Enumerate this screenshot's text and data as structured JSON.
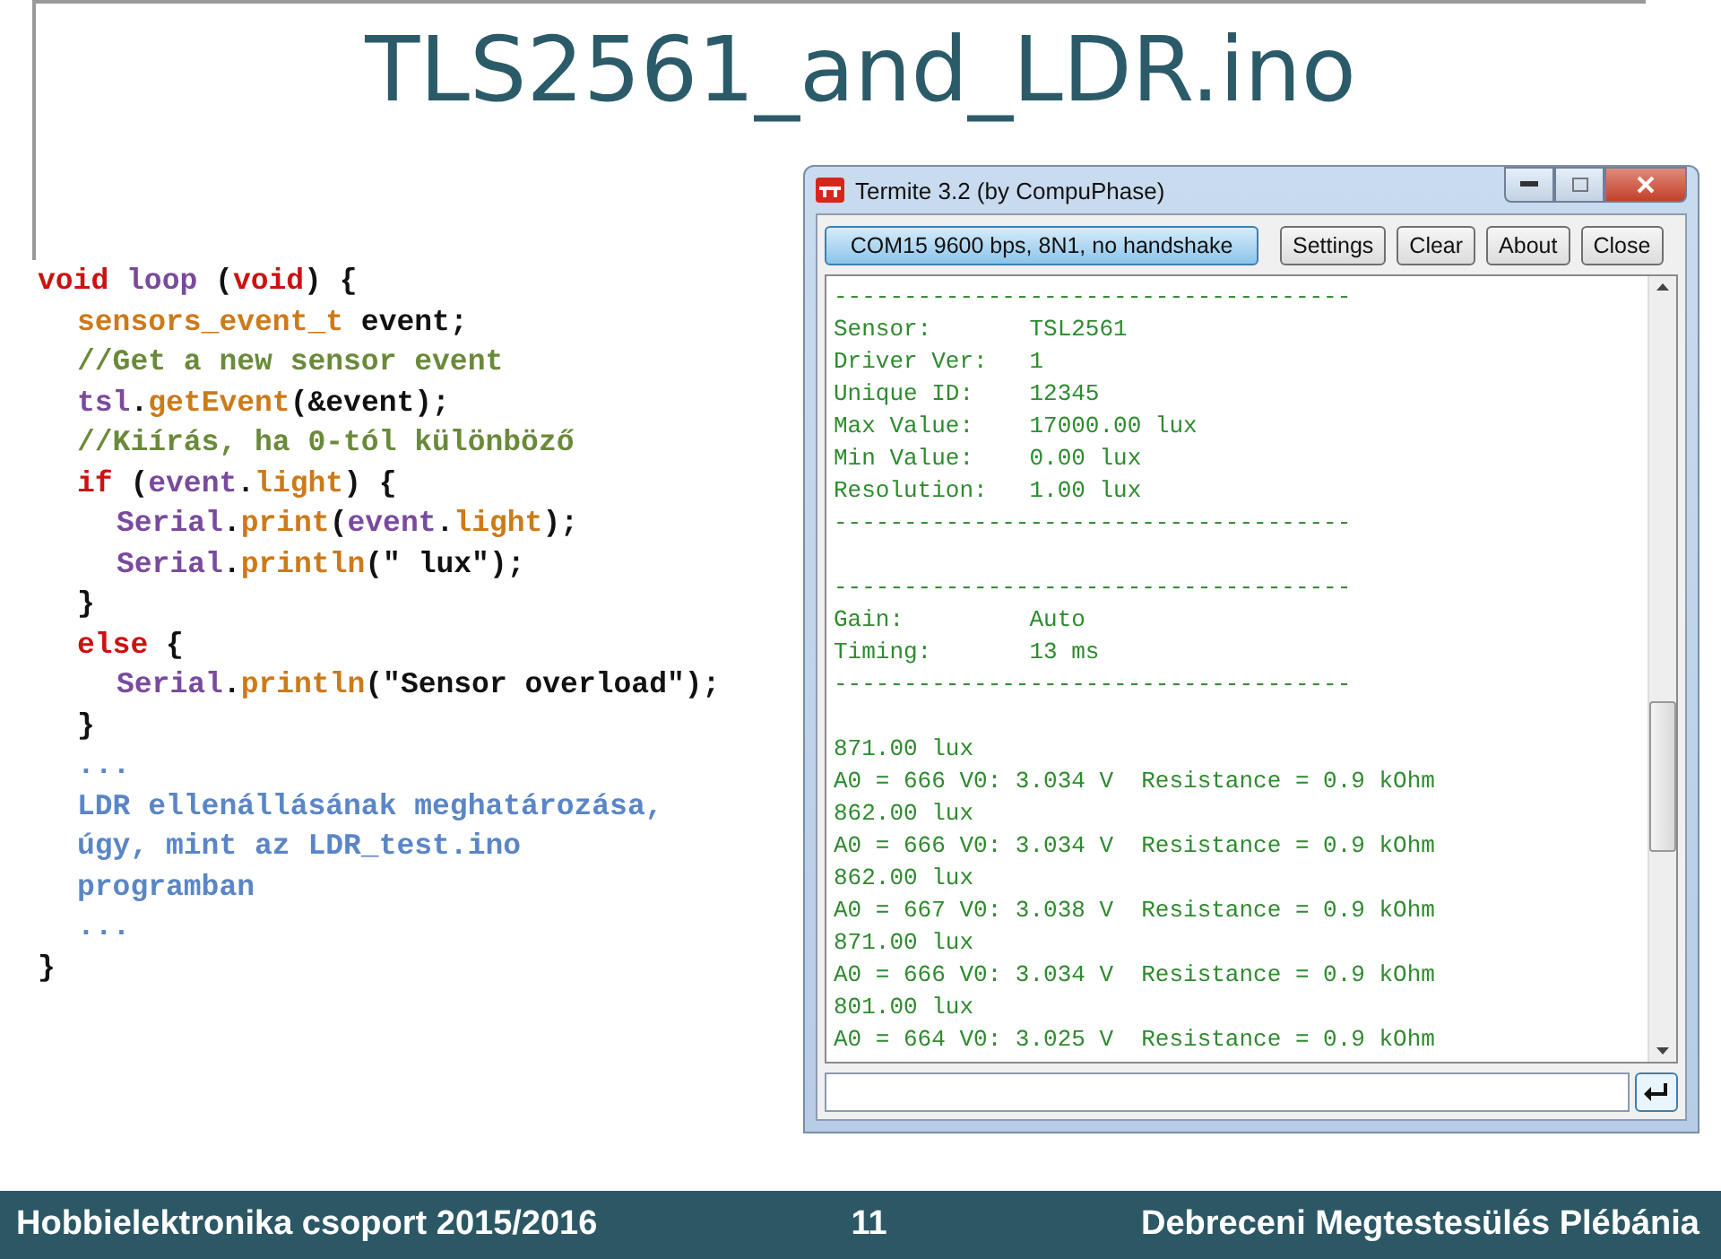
{
  "slide": {
    "title": "TLS2561_and_LDR.ino"
  },
  "code": {
    "lines": [
      {
        "tokens": [
          {
            "kind": "keyword",
            "text": "void"
          },
          {
            "kind": "object",
            "text": " loop"
          },
          {
            "kind": "plain",
            "text": " ("
          },
          {
            "kind": "keyword",
            "text": "void"
          },
          {
            "kind": "plain",
            "text": ") {"
          }
        ],
        "children": [
          {
            "tokens": [
              {
                "kind": "method",
                "text": "sensors_event_t"
              },
              {
                "kind": "plain",
                "text": " event;"
              }
            ]
          },
          {
            "tokens": [
              {
                "kind": "comment",
                "text": "//Get a new sensor event"
              }
            ]
          },
          {
            "tokens": [
              {
                "kind": "object",
                "text": "tsl"
              },
              {
                "kind": "plain",
                "text": "."
              },
              {
                "kind": "method",
                "text": "getEvent"
              },
              {
                "kind": "plain",
                "text": "(&event);"
              }
            ]
          },
          {
            "tokens": [
              {
                "kind": "comment",
                "text": "//Kiírás, ha 0-tól különböző"
              }
            ]
          },
          {
            "tokens": [
              {
                "kind": "keyword",
                "text": "if"
              },
              {
                "kind": "plain",
                "text": " ("
              },
              {
                "kind": "object",
                "text": "event"
              },
              {
                "kind": "plain",
                "text": "."
              },
              {
                "kind": "method",
                "text": "light"
              },
              {
                "kind": "plain",
                "text": ") {"
              }
            ],
            "children": [
              {
                "tokens": [
                  {
                    "kind": "object",
                    "text": "Serial"
                  },
                  {
                    "kind": "plain",
                    "text": "."
                  },
                  {
                    "kind": "method",
                    "text": "print"
                  },
                  {
                    "kind": "plain",
                    "text": "("
                  },
                  {
                    "kind": "object",
                    "text": "event"
                  },
                  {
                    "kind": "plain",
                    "text": "."
                  },
                  {
                    "kind": "method",
                    "text": "light"
                  },
                  {
                    "kind": "plain",
                    "text": ");"
                  }
                ]
              },
              {
                "tokens": [
                  {
                    "kind": "object",
                    "text": "Serial"
                  },
                  {
                    "kind": "plain",
                    "text": "."
                  },
                  {
                    "kind": "method",
                    "text": "println"
                  },
                  {
                    "kind": "plain",
                    "text": "(\" lux\");"
                  }
                ]
              }
            ]
          },
          {
            "tokens": [
              {
                "kind": "plain",
                "text": "}"
              }
            ]
          },
          {
            "tokens": [
              {
                "kind": "keyword",
                "text": "else"
              },
              {
                "kind": "plain",
                "text": " {"
              }
            ],
            "children": [
              {
                "tokens": [
                  {
                    "kind": "object",
                    "text": "Serial"
                  },
                  {
                    "kind": "plain",
                    "text": "."
                  },
                  {
                    "kind": "method",
                    "text": "println"
                  },
                  {
                    "kind": "plain",
                    "text": "(\"Sensor overload\");"
                  }
                ]
              }
            ]
          },
          {
            "tokens": [
              {
                "kind": "plain",
                "text": "}"
              }
            ]
          },
          {
            "tokens": [
              {
                "kind": "note",
                "text": "..."
              }
            ]
          },
          {
            "tokens": [
              {
                "kind": "note",
                "text": "LDR ellenállásának meghatározása,"
              }
            ]
          },
          {
            "tokens": [
              {
                "kind": "note",
                "text": "úgy, mint az LDR_test.ino"
              }
            ]
          },
          {
            "tokens": [
              {
                "kind": "note",
                "text": "programban"
              }
            ]
          },
          {
            "tokens": [
              {
                "kind": "note",
                "text": "..."
              }
            ]
          }
        ]
      },
      {
        "tokens": [
          {
            "kind": "plain",
            "text": "}"
          }
        ]
      }
    ]
  },
  "terminal": {
    "window_title": "Termite 3.2 (by CompuPhase)",
    "buttons": [
      {
        "label": "COM15 9600 bps, 8N1, no handshake",
        "kind": "port"
      },
      {
        "label": "Settings",
        "kind": "plain"
      },
      {
        "label": "Clear",
        "kind": "plain"
      },
      {
        "label": "About",
        "kind": "plain"
      },
      {
        "label": "Close",
        "kind": "plain"
      }
    ],
    "output": [
      {
        "lines": [
          "-------------------------------------",
          "Sensor:       TSL2561",
          "Driver Ver:   1",
          "Unique ID:    12345",
          "Max Value:    17000.00 lux",
          "Min Value:    0.00 lux",
          "Resolution:   1.00 lux",
          "-------------------------------------"
        ]
      },
      {
        "lines": [
          "-------------------------------------",
          "Gain:         Auto",
          "Timing:       13 ms",
          "-------------------------------------"
        ]
      },
      {
        "lines": [
          "871.00 lux",
          "A0 = 666 V0: 3.034 V  Resistance = 0.9 kOhm",
          "862.00 lux",
          "A0 = 666 V0: 3.034 V  Resistance = 0.9 kOhm",
          "862.00 lux",
          "A0 = 667 V0: 3.038 V  Resistance = 0.9 kOhm",
          "871.00 lux",
          "A0 = 666 V0: 3.034 V  Resistance = 0.9 kOhm",
          "801.00 lux",
          "A0 = 664 V0: 3.025 V  Resistance = 0.9 kOhm"
        ]
      }
    ]
  },
  "footer": {
    "left": "Hobbielektronika csoport 2015/2016",
    "page": "11",
    "right": "Debreceni Megtestesülés Plébánia"
  }
}
